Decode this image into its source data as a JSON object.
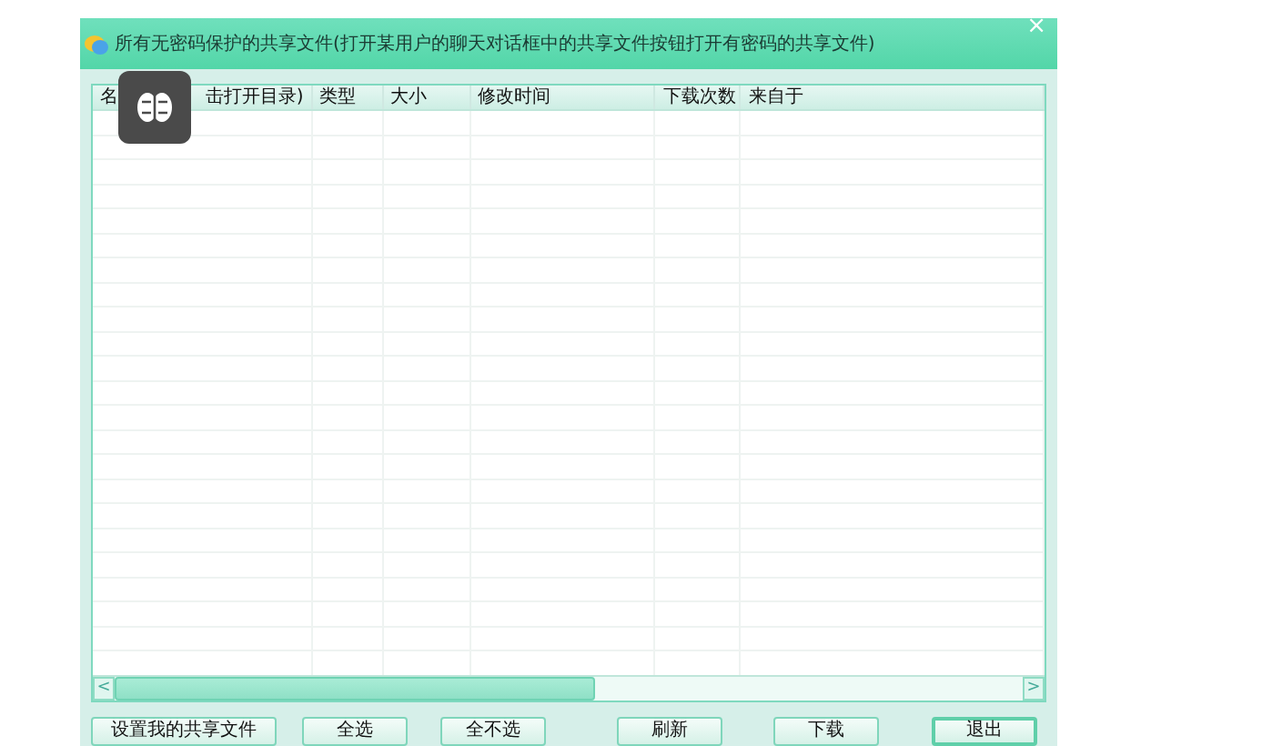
{
  "window": {
    "title": "所有无密码保护的共享文件(打开某用户的聊天对话框中的共享文件按钮打开有密码的共享文件)",
    "close": "×"
  },
  "table": {
    "columns": [
      {
        "label_parts": [
          "名",
          "击打开目录)"
        ]
      },
      {
        "label_parts": [
          "类型"
        ]
      },
      {
        "label_parts": [
          "大小"
        ]
      },
      {
        "label_parts": [
          "修改时间"
        ]
      },
      {
        "label_parts": [
          "下载次数"
        ]
      },
      {
        "label_parts": [
          "来自于"
        ]
      }
    ],
    "scrollbar": {
      "left_arrow": "<",
      "right_arrow": ">"
    }
  },
  "buttons": [
    {
      "label": "设置我的共享文件",
      "selected": false
    },
    {
      "label": "全选",
      "selected": false
    },
    {
      "label": "全不选",
      "selected": false
    },
    {
      "label": "刷新",
      "selected": false
    },
    {
      "label": "下载",
      "selected": false
    },
    {
      "label": "退出",
      "selected": true
    }
  ]
}
